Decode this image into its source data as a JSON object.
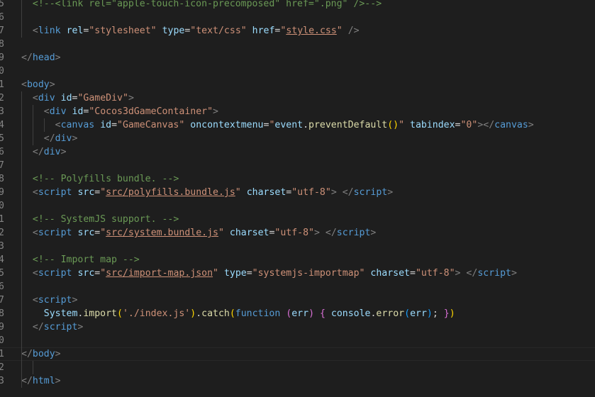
{
  "editor": {
    "language": "html",
    "colors": {
      "background": "#1e1e1e",
      "tag": "#569cd6",
      "attribute": "#9cdcfe",
      "string": "#ce9178",
      "comment": "#6a9955",
      "function": "#dcdcaa"
    },
    "lines": [
      {
        "number": "5",
        "tokens": [
          {
            "t": "comment",
            "v": "  <!--<link rel=\"apple-touch-icon-precomposed\" href=\".png\" />-->"
          }
        ]
      },
      {
        "number": "6",
        "tokens": []
      },
      {
        "number": "7",
        "tokens": [
          {
            "t": "text",
            "v": "  "
          },
          {
            "t": "punc",
            "v": "<"
          },
          {
            "t": "tag",
            "v": "link"
          },
          {
            "t": "text",
            "v": " "
          },
          {
            "t": "attr",
            "v": "rel"
          },
          {
            "t": "text",
            "v": "="
          },
          {
            "t": "str",
            "v": "\"stylesheet\""
          },
          {
            "t": "text",
            "v": " "
          },
          {
            "t": "attr",
            "v": "type"
          },
          {
            "t": "text",
            "v": "="
          },
          {
            "t": "str",
            "v": "\"text/css\""
          },
          {
            "t": "text",
            "v": " "
          },
          {
            "t": "attr",
            "v": "href"
          },
          {
            "t": "text",
            "v": "="
          },
          {
            "t": "str",
            "v": "\""
          },
          {
            "t": "link",
            "v": "style.css"
          },
          {
            "t": "str",
            "v": "\""
          },
          {
            "t": "text",
            "v": " "
          },
          {
            "t": "punc",
            "v": "/>"
          }
        ]
      },
      {
        "number": "8",
        "tokens": []
      },
      {
        "number": "9",
        "tokens": [
          {
            "t": "punc",
            "v": "</"
          },
          {
            "t": "tag",
            "v": "head"
          },
          {
            "t": "punc",
            "v": ">"
          }
        ]
      },
      {
        "number": "0",
        "tokens": []
      },
      {
        "number": "1",
        "tokens": [
          {
            "t": "punc",
            "v": "<"
          },
          {
            "t": "tag",
            "v": "body"
          },
          {
            "t": "punc",
            "v": ">"
          }
        ]
      },
      {
        "number": "2",
        "tokens": [
          {
            "t": "text",
            "v": "  "
          },
          {
            "t": "punc",
            "v": "<"
          },
          {
            "t": "tag",
            "v": "div"
          },
          {
            "t": "text",
            "v": " "
          },
          {
            "t": "attr",
            "v": "id"
          },
          {
            "t": "text",
            "v": "="
          },
          {
            "t": "str",
            "v": "\"GameDiv\""
          },
          {
            "t": "punc",
            "v": ">"
          }
        ]
      },
      {
        "number": "3",
        "tokens": [
          {
            "t": "text",
            "v": "    "
          },
          {
            "t": "punc",
            "v": "<"
          },
          {
            "t": "tag",
            "v": "div"
          },
          {
            "t": "text",
            "v": " "
          },
          {
            "t": "attr",
            "v": "id"
          },
          {
            "t": "text",
            "v": "="
          },
          {
            "t": "str",
            "v": "\"Cocos3dGameContainer\""
          },
          {
            "t": "punc",
            "v": ">"
          }
        ]
      },
      {
        "number": "4",
        "tokens": [
          {
            "t": "text",
            "v": "      "
          },
          {
            "t": "punc",
            "v": "<"
          },
          {
            "t": "tag",
            "v": "canvas"
          },
          {
            "t": "text",
            "v": " "
          },
          {
            "t": "attr",
            "v": "id"
          },
          {
            "t": "text",
            "v": "="
          },
          {
            "t": "str",
            "v": "\"GameCanvas\""
          },
          {
            "t": "text",
            "v": " "
          },
          {
            "t": "attr",
            "v": "oncontextmenu"
          },
          {
            "t": "text",
            "v": "="
          },
          {
            "t": "str",
            "v": "\""
          },
          {
            "t": "var",
            "v": "event"
          },
          {
            "t": "text",
            "v": "."
          },
          {
            "t": "fn",
            "v": "preventDefault"
          },
          {
            "t": "b1",
            "v": "()"
          },
          {
            "t": "str",
            "v": "\""
          },
          {
            "t": "text",
            "v": " "
          },
          {
            "t": "attr",
            "v": "tabindex"
          },
          {
            "t": "text",
            "v": "="
          },
          {
            "t": "str",
            "v": "\"0\""
          },
          {
            "t": "punc",
            "v": "></"
          },
          {
            "t": "tag",
            "v": "canvas"
          },
          {
            "t": "punc",
            "v": ">"
          }
        ]
      },
      {
        "number": "5",
        "tokens": [
          {
            "t": "text",
            "v": "    "
          },
          {
            "t": "punc",
            "v": "</"
          },
          {
            "t": "tag",
            "v": "div"
          },
          {
            "t": "punc",
            "v": ">"
          }
        ]
      },
      {
        "number": "6",
        "tokens": [
          {
            "t": "text",
            "v": "  "
          },
          {
            "t": "punc",
            "v": "</"
          },
          {
            "t": "tag",
            "v": "div"
          },
          {
            "t": "punc",
            "v": ">"
          }
        ]
      },
      {
        "number": "7",
        "tokens": []
      },
      {
        "number": "8",
        "tokens": [
          {
            "t": "comment",
            "v": "  <!-- Polyfills bundle. -->"
          }
        ]
      },
      {
        "number": "9",
        "tokens": [
          {
            "t": "text",
            "v": "  "
          },
          {
            "t": "punc",
            "v": "<"
          },
          {
            "t": "tag",
            "v": "script"
          },
          {
            "t": "text",
            "v": " "
          },
          {
            "t": "attr",
            "v": "src"
          },
          {
            "t": "text",
            "v": "="
          },
          {
            "t": "str",
            "v": "\""
          },
          {
            "t": "link",
            "v": "src/polyfills.bundle.js"
          },
          {
            "t": "str",
            "v": "\""
          },
          {
            "t": "text",
            "v": " "
          },
          {
            "t": "attr",
            "v": "charset"
          },
          {
            "t": "text",
            "v": "="
          },
          {
            "t": "str",
            "v": "\"utf-8\""
          },
          {
            "t": "punc",
            "v": ">"
          },
          {
            "t": "text",
            "v": " "
          },
          {
            "t": "punc",
            "v": "</"
          },
          {
            "t": "tag",
            "v": "script"
          },
          {
            "t": "punc",
            "v": ">"
          }
        ]
      },
      {
        "number": "0",
        "tokens": []
      },
      {
        "number": "1",
        "tokens": [
          {
            "t": "comment",
            "v": "  <!-- SystemJS support. -->"
          }
        ]
      },
      {
        "number": "2",
        "tokens": [
          {
            "t": "text",
            "v": "  "
          },
          {
            "t": "punc",
            "v": "<"
          },
          {
            "t": "tag",
            "v": "script"
          },
          {
            "t": "text",
            "v": " "
          },
          {
            "t": "attr",
            "v": "src"
          },
          {
            "t": "text",
            "v": "="
          },
          {
            "t": "str",
            "v": "\""
          },
          {
            "t": "link",
            "v": "src/system.bundle.js"
          },
          {
            "t": "str",
            "v": "\""
          },
          {
            "t": "text",
            "v": " "
          },
          {
            "t": "attr",
            "v": "charset"
          },
          {
            "t": "text",
            "v": "="
          },
          {
            "t": "str",
            "v": "\"utf-8\""
          },
          {
            "t": "punc",
            "v": ">"
          },
          {
            "t": "text",
            "v": " "
          },
          {
            "t": "punc",
            "v": "</"
          },
          {
            "t": "tag",
            "v": "script"
          },
          {
            "t": "punc",
            "v": ">"
          }
        ]
      },
      {
        "number": "3",
        "tokens": []
      },
      {
        "number": "4",
        "tokens": [
          {
            "t": "comment",
            "v": "  <!-- Import map -->"
          }
        ]
      },
      {
        "number": "5",
        "tokens": [
          {
            "t": "text",
            "v": "  "
          },
          {
            "t": "punc",
            "v": "<"
          },
          {
            "t": "tag",
            "v": "script"
          },
          {
            "t": "text",
            "v": " "
          },
          {
            "t": "attr",
            "v": "src"
          },
          {
            "t": "text",
            "v": "="
          },
          {
            "t": "str",
            "v": "\""
          },
          {
            "t": "link",
            "v": "src/import-map.json"
          },
          {
            "t": "str",
            "v": "\""
          },
          {
            "t": "text",
            "v": " "
          },
          {
            "t": "attr",
            "v": "type"
          },
          {
            "t": "text",
            "v": "="
          },
          {
            "t": "str",
            "v": "\"systemjs-importmap\""
          },
          {
            "t": "text",
            "v": " "
          },
          {
            "t": "attr",
            "v": "charset"
          },
          {
            "t": "text",
            "v": "="
          },
          {
            "t": "str",
            "v": "\"utf-8\""
          },
          {
            "t": "punc",
            "v": ">"
          },
          {
            "t": "text",
            "v": " "
          },
          {
            "t": "punc",
            "v": "</"
          },
          {
            "t": "tag",
            "v": "script"
          },
          {
            "t": "punc",
            "v": ">"
          }
        ]
      },
      {
        "number": "6",
        "tokens": []
      },
      {
        "number": "7",
        "tokens": [
          {
            "t": "text",
            "v": "  "
          },
          {
            "t": "punc",
            "v": "<"
          },
          {
            "t": "tag",
            "v": "script"
          },
          {
            "t": "punc",
            "v": ">"
          }
        ]
      },
      {
        "number": "8",
        "tokens": [
          {
            "t": "text",
            "v": "    "
          },
          {
            "t": "var",
            "v": "System"
          },
          {
            "t": "text",
            "v": "."
          },
          {
            "t": "fn",
            "v": "import"
          },
          {
            "t": "b1",
            "v": "("
          },
          {
            "t": "str",
            "v": "'./index.js'"
          },
          {
            "t": "b1",
            "v": ")"
          },
          {
            "t": "text",
            "v": "."
          },
          {
            "t": "fn",
            "v": "catch"
          },
          {
            "t": "b1",
            "v": "("
          },
          {
            "t": "kw",
            "v": "function"
          },
          {
            "t": "text",
            "v": " "
          },
          {
            "t": "b2",
            "v": "("
          },
          {
            "t": "var",
            "v": "err"
          },
          {
            "t": "b2",
            "v": ")"
          },
          {
            "t": "text",
            "v": " "
          },
          {
            "t": "b2",
            "v": "{"
          },
          {
            "t": "text",
            "v": " "
          },
          {
            "t": "var",
            "v": "console"
          },
          {
            "t": "text",
            "v": "."
          },
          {
            "t": "fn",
            "v": "error"
          },
          {
            "t": "b3",
            "v": "("
          },
          {
            "t": "var",
            "v": "err"
          },
          {
            "t": "b3",
            "v": ")"
          },
          {
            "t": "text",
            "v": "; "
          },
          {
            "t": "b2",
            "v": "}"
          },
          {
            "t": "b1",
            "v": ")"
          }
        ]
      },
      {
        "number": "9",
        "tokens": [
          {
            "t": "text",
            "v": "  "
          },
          {
            "t": "punc",
            "v": "</"
          },
          {
            "t": "tag",
            "v": "script"
          },
          {
            "t": "punc",
            "v": ">"
          }
        ]
      },
      {
        "number": "0",
        "tokens": []
      },
      {
        "number": "1",
        "current": true,
        "tokens": [
          {
            "t": "punc",
            "v": "</"
          },
          {
            "t": "tag",
            "v": "body"
          },
          {
            "t": "punc",
            "v": ">"
          }
        ]
      },
      {
        "number": "2",
        "tokens": []
      },
      {
        "number": "3",
        "tokens": [
          {
            "t": "punc",
            "v": "</"
          },
          {
            "t": "tag",
            "v": "html"
          },
          {
            "t": "punc",
            "v": ">"
          }
        ]
      }
    ]
  }
}
